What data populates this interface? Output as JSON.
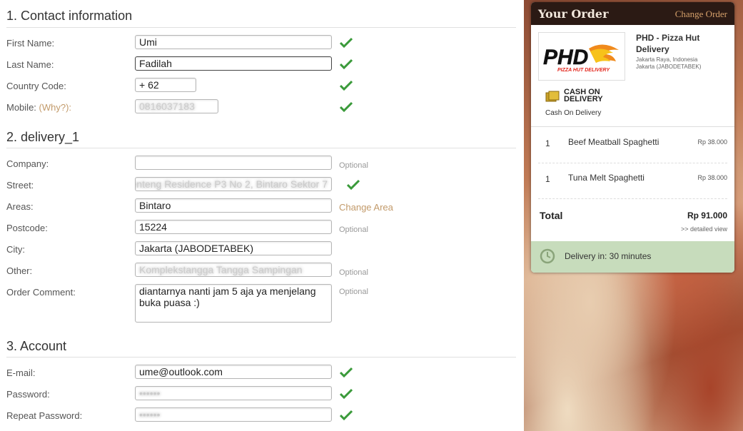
{
  "sections": {
    "contact": "1. Contact information",
    "delivery": "2. delivery_1",
    "account": "3. Account"
  },
  "labels": {
    "first_name": "First Name:",
    "last_name": "Last Name:",
    "country_code": "Country Code:",
    "mobile": "Mobile:",
    "why": "(Why?):",
    "company": "Company:",
    "street": "Street:",
    "areas": "Areas:",
    "postcode": "Postcode:",
    "city": "City:",
    "other": "Other:",
    "order_comment": "Order Comment:",
    "email": "E-mail:",
    "password": "Password:",
    "repeat_password": "Repeat Password:"
  },
  "values": {
    "first_name": "Umi",
    "last_name": "Fadilah",
    "country_code": "+ 62",
    "mobile": "0816037183",
    "company": "",
    "street": "Menteng Residence P3 No 2, Bintaro Sektor 7",
    "areas": "Bintaro",
    "postcode": "15224",
    "city": "Jakarta (JABODETABEK)",
    "other": "Komplekstangga Tangga Sampingan",
    "order_comment": "diantarnya nanti jam 5 aja ya menjelang buka puasa :)",
    "email": "ume@outlook.com",
    "password": "••••••",
    "repeat_password": "••••••"
  },
  "optional_text": "Optional",
  "change_area": "Change Area",
  "order": {
    "title": "Your Order",
    "change_order": "Change Order",
    "logo_text": "PHD",
    "logo_subtext": "PIZZA HUT DELIVERY",
    "shop_name": "PHD - Pizza Hut Delivery",
    "shop_addr_1": "Jakarta Raya, Indonesia",
    "shop_addr_2": "Jakarta (JABODETABEK)",
    "cod_badge_1": "CASH ON",
    "cod_badge_2": "DELIVERY",
    "payment": "Cash On Delivery",
    "items": [
      {
        "qty": "1",
        "name": "Beef Meatball Spaghetti",
        "price": "Rp 38.000"
      },
      {
        "qty": "1",
        "name": "Tuna Melt Spaghetti",
        "price": "Rp 38.000"
      }
    ],
    "total_label": "Total",
    "total_value": "Rp 91.000",
    "details_link": ">> detailed view",
    "delivery_time": "Delivery in: 30 minutes"
  },
  "colors": {
    "check_green": "#3a9a3a",
    "accent_tan": "#c29a6a",
    "header_dark": "#2b1a14",
    "delivery_bg": "#c7dcbc"
  }
}
